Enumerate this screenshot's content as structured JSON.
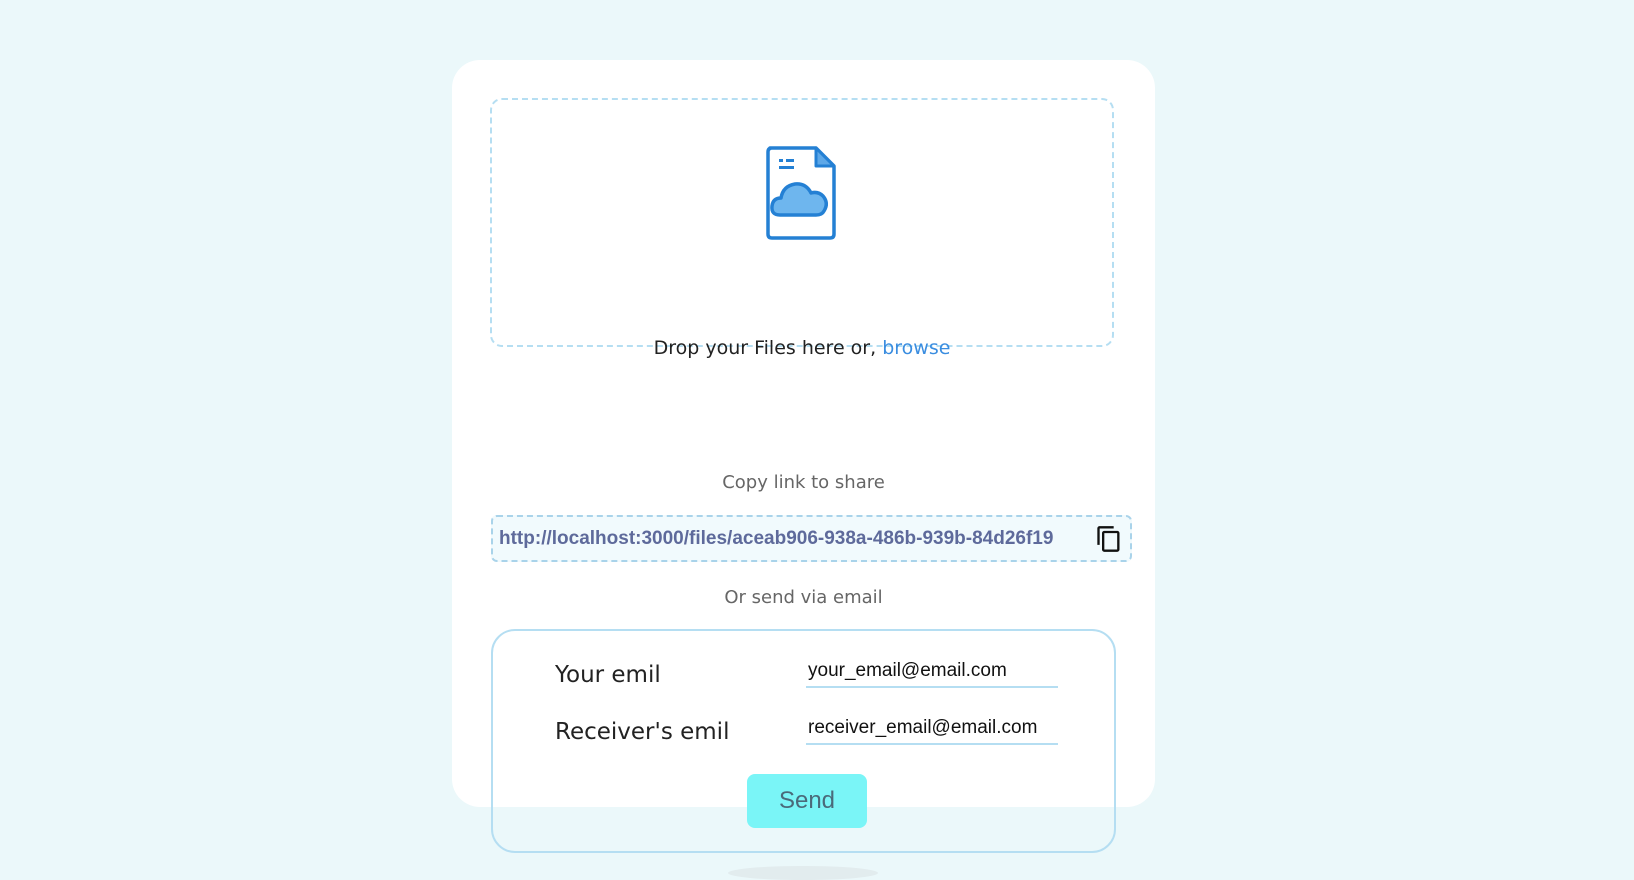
{
  "upload": {
    "icon": "file-cloud-icon",
    "drop_text": "Drop your Files here or, ",
    "browse_label": "browse"
  },
  "share": {
    "title": "Copy link to share",
    "link": "http://localhost:3000/files/aceab906-938a-486b-939b-84d26f19",
    "copy_icon": "copy-icon"
  },
  "email": {
    "title": "Or send via email",
    "sender_label": "Your emil",
    "sender_value": "your_email@email.com",
    "receiver_label": "Receiver's emil",
    "receiver_value": "receiver_email@email.com",
    "send_label": "Send"
  },
  "colors": {
    "background": "#ebf8fa",
    "card": "#ffffff",
    "accent": "#3a8de0",
    "dashed_border": "#b5def2",
    "send_button": "#7af5f7",
    "link_text": "#5e6a9b"
  }
}
